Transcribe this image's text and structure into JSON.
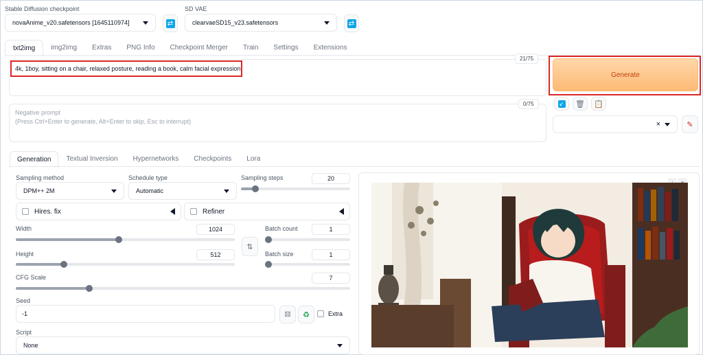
{
  "checkpoint": {
    "label": "Stable Diffusion checkpoint",
    "value": "novaAnime_v20.safetensors [1645110974]"
  },
  "vae": {
    "label": "SD VAE",
    "value": "clearvaeSD15_v23.safetensors"
  },
  "main_tabs": [
    {
      "label": "txt2img"
    },
    {
      "label": "img2img"
    },
    {
      "label": "Extras"
    },
    {
      "label": "PNG Info"
    },
    {
      "label": "Checkpoint Merger"
    },
    {
      "label": "Train"
    },
    {
      "label": "Settings"
    },
    {
      "label": "Extensions"
    }
  ],
  "prompt": {
    "value": "4k, 1boy, sitting on a chair, relaxed posture, reading a book, calm facial expression",
    "counter": "21/75"
  },
  "negative_prompt": {
    "placeholder": "Negative prompt\n(Press Ctrl+Enter to generate, Alt+Enter to skip, Esc to interrupt)",
    "counter": "0/75"
  },
  "generate_label": "Generate",
  "styles": {
    "clear": "×"
  },
  "sub_tabs": [
    {
      "label": "Generation"
    },
    {
      "label": "Textual Inversion"
    },
    {
      "label": "Hypernetworks"
    },
    {
      "label": "Checkpoints"
    },
    {
      "label": "Lora"
    }
  ],
  "sampling_method": {
    "label": "Sampling method",
    "value": "DPM++ 2M"
  },
  "schedule_type": {
    "label": "Schedule type",
    "value": "Automatic"
  },
  "sampling_steps": {
    "label": "Sampling steps",
    "value": "20",
    "fraction": 0.13
  },
  "hires": {
    "label": "Hires. fix"
  },
  "refiner": {
    "label": "Refiner"
  },
  "width": {
    "label": "Width",
    "value": "1024",
    "fraction": 0.47
  },
  "height": {
    "label": "Height",
    "value": "512",
    "fraction": 0.22
  },
  "batch_count": {
    "label": "Batch count",
    "value": "1",
    "fraction": 0.0
  },
  "batch_size": {
    "label": "Batch size",
    "value": "1",
    "fraction": 0.0
  },
  "cfg_scale": {
    "label": "CFG Scale",
    "value": "7",
    "fraction": 0.22
  },
  "seed": {
    "label": "Seed",
    "value": "-1",
    "extra_label": "Extra"
  },
  "script": {
    "label": "Script",
    "value": "None"
  },
  "colors": {
    "accent": "#f97316",
    "highlight": "#dc2626",
    "info": "#0ea5e9"
  }
}
